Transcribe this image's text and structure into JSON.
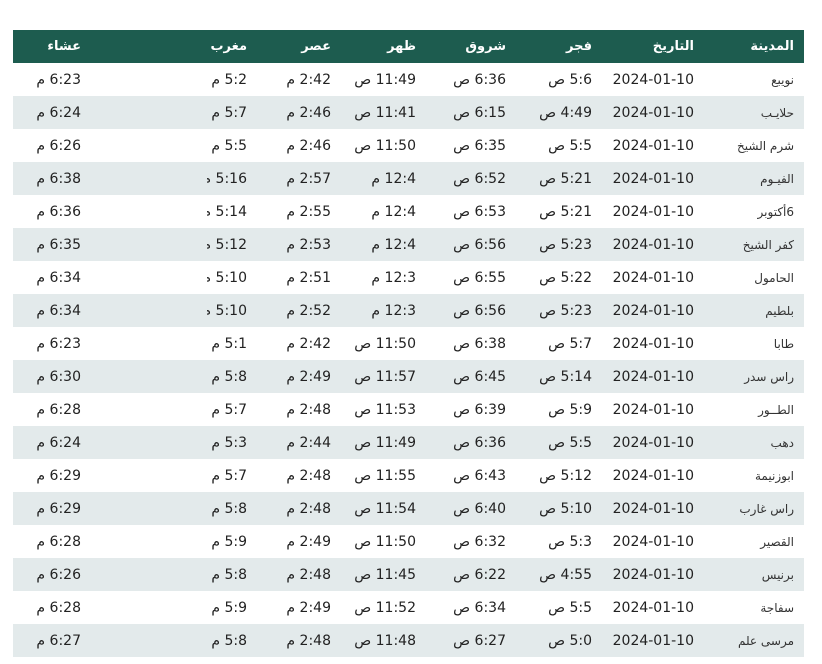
{
  "table": {
    "headers": {
      "city": "المدينة",
      "date": "التاريخ",
      "fajr": "فجر",
      "sunrise": "شروق",
      "dhuhr": "ظهر",
      "asr": "عصر",
      "maghrib": "مغرب",
      "isha": "عشاء"
    },
    "rows": [
      {
        "city": "نويبع",
        "date": "2024-01-10",
        "fajr": "5:6 ص",
        "sunrise": "6:36 ص",
        "dhuhr": "11:49 ص",
        "asr": "2:42 م",
        "maghrib": "5:2 م",
        "isha": "6:23 م"
      },
      {
        "city": "حلايـب",
        "date": "2024-01-10",
        "fajr": "4:49 ص",
        "sunrise": "6:15 ص",
        "dhuhr": "11:41 ص",
        "asr": "2:46 م",
        "maghrib": "5:7 م",
        "isha": "6:24 م"
      },
      {
        "city": "شرم الشيخ",
        "date": "2024-01-10",
        "fajr": "5:5 ص",
        "sunrise": "6:35 ص",
        "dhuhr": "11:50 ص",
        "asr": "2:46 م",
        "maghrib": "5:5 م",
        "isha": "6:26 م"
      },
      {
        "city": "الفيـوم",
        "date": "2024-01-10",
        "fajr": "5:21 ص",
        "sunrise": "6:52 ص",
        "dhuhr": "12:4 م",
        "asr": "2:57 م",
        "maghrib": "5:16 م",
        "isha": "6:38 م"
      },
      {
        "city": "6أكتوبر",
        "date": "2024-01-10",
        "fajr": "5:21 ص",
        "sunrise": "6:53 ص",
        "dhuhr": "12:4 م",
        "asr": "2:55 م",
        "maghrib": "5:14 م",
        "isha": "6:36 م"
      },
      {
        "city": "كفر الشيخ",
        "date": "2024-01-10",
        "fajr": "5:23 ص",
        "sunrise": "6:56 ص",
        "dhuhr": "12:4 م",
        "asr": "2:53 م",
        "maghrib": "5:12 م",
        "isha": "6:35 م"
      },
      {
        "city": "الحامول",
        "date": "2024-01-10",
        "fajr": "5:22 ص",
        "sunrise": "6:55 ص",
        "dhuhr": "12:3 م",
        "asr": "2:51 م",
        "maghrib": "5:10 م",
        "isha": "6:34 م"
      },
      {
        "city": "بلطيم",
        "date": "2024-01-10",
        "fajr": "5:23 ص",
        "sunrise": "6:56 ص",
        "dhuhr": "12:3 م",
        "asr": "2:52 م",
        "maghrib": "5:10 م",
        "isha": "6:34 م"
      },
      {
        "city": "طابا",
        "date": "2024-01-10",
        "fajr": "5:7 ص",
        "sunrise": "6:38 ص",
        "dhuhr": "11:50 ص",
        "asr": "2:42 م",
        "maghrib": "5:1 م",
        "isha": "6:23 م"
      },
      {
        "city": "راس سدر",
        "date": "2024-01-10",
        "fajr": "5:14 ص",
        "sunrise": "6:45 ص",
        "dhuhr": "11:57 ص",
        "asr": "2:49 م",
        "maghrib": "5:8 م",
        "isha": "6:30 م"
      },
      {
        "city": "الطــور",
        "date": "2024-01-10",
        "fajr": "5:9 ص",
        "sunrise": "6:39 ص",
        "dhuhr": "11:53 ص",
        "asr": "2:48 م",
        "maghrib": "5:7 م",
        "isha": "6:28 م"
      },
      {
        "city": "دهب",
        "date": "2024-01-10",
        "fajr": "5:5 ص",
        "sunrise": "6:36 ص",
        "dhuhr": "11:49 ص",
        "asr": "2:44 م",
        "maghrib": "5:3 م",
        "isha": "6:24 م"
      },
      {
        "city": "ابوزنيمة",
        "date": "2024-01-10",
        "fajr": "5:12 ص",
        "sunrise": "6:43 ص",
        "dhuhr": "11:55 ص",
        "asr": "2:48 م",
        "maghrib": "5:7 م",
        "isha": "6:29 م"
      },
      {
        "city": "راس غارب",
        "date": "2024-01-10",
        "fajr": "5:10 ص",
        "sunrise": "6:40 ص",
        "dhuhr": "11:54 ص",
        "asr": "2:48 م",
        "maghrib": "5:8 م",
        "isha": "6:29 م"
      },
      {
        "city": "القصير",
        "date": "2024-01-10",
        "fajr": "5:3 ص",
        "sunrise": "6:32 ص",
        "dhuhr": "11:50 ص",
        "asr": "2:49 م",
        "maghrib": "5:9 م",
        "isha": "6:28 م"
      },
      {
        "city": "برنيس",
        "date": "2024-01-10",
        "fajr": "4:55 ص",
        "sunrise": "6:22 ص",
        "dhuhr": "11:45 ص",
        "asr": "2:48 م",
        "maghrib": "5:8 م",
        "isha": "6:26 م"
      },
      {
        "city": "سفاجة",
        "date": "2024-01-10",
        "fajr": "5:5 ص",
        "sunrise": "6:34 ص",
        "dhuhr": "11:52 ص",
        "asr": "2:49 م",
        "maghrib": "5:9 م",
        "isha": "6:28 م"
      },
      {
        "city": "مرسى علم",
        "date": "2024-01-10",
        "fajr": "5:0 ص",
        "sunrise": "6:27 ص",
        "dhuhr": "11:48 ص",
        "asr": "2:48 م",
        "maghrib": "5:8 م",
        "isha": "6:27 م"
      }
    ]
  },
  "colors": {
    "header_bg": "#1d5c4f",
    "stripe_bg": "#e3eaeb"
  }
}
